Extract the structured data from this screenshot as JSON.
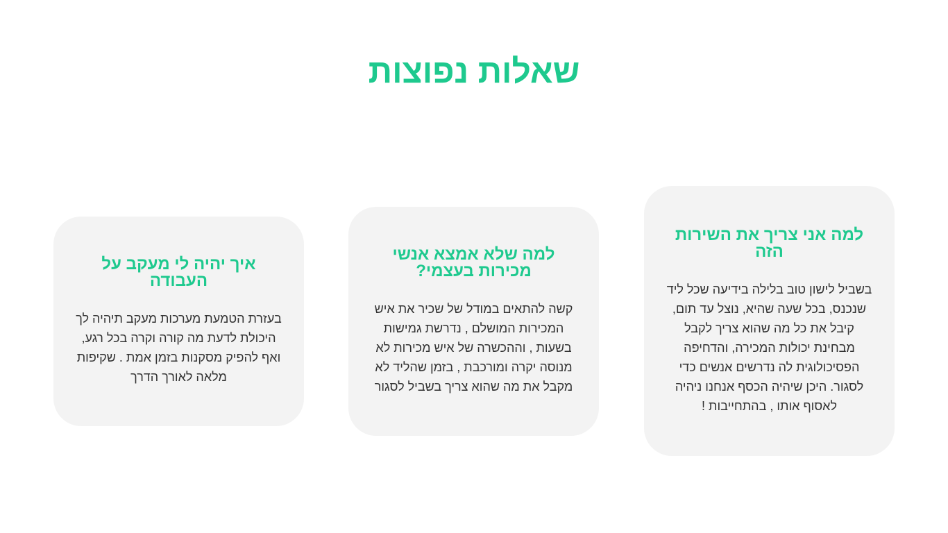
{
  "title": "שאלות נפוצות",
  "colors": {
    "accent": "#1ec98e",
    "card_background": "#f3f3f3",
    "body_text": "#333333"
  },
  "cards": [
    {
      "title": "למה אני צריך את השירות הזה",
      "body": "בשביל לישון טוב בלילה בידיעה שכל ליד שנכנס, בכל שעה שהיא, נוצל עד תום, קיבל את כל מה שהוא צריך לקבל מבחינת יכולות המכירה, והדחיפה הפסיכולוגית לה נדרשים אנשים כדי לסגור. היכן שיהיה הכסף אנחנו ניהיה לאסוף אותו , בהתחייבות !"
    },
    {
      "title": "למה שלא אמצא אנשי מכירות בעצמי?",
      "body": "קשה להתאים במודל של שכיר את איש המכירות המושלם , נדרשת גמישות בשעות , וההכשרה של איש מכירות לא מנוסה יקרה ומורכבת , בזמן שהליד לא מקבל את מה שהוא צריך בשביל לסגור"
    },
    {
      "title": "איך יהיה לי מעקב על העבודה",
      "body": "בעזרת הטמעת מערכות מעקב תיהיה לך היכולת לדעת מה קורה וקרה בכל רגע, ואף להפיק מסקנות בזמן אמת . שקיפות מלאה לאורך הדרך"
    }
  ]
}
